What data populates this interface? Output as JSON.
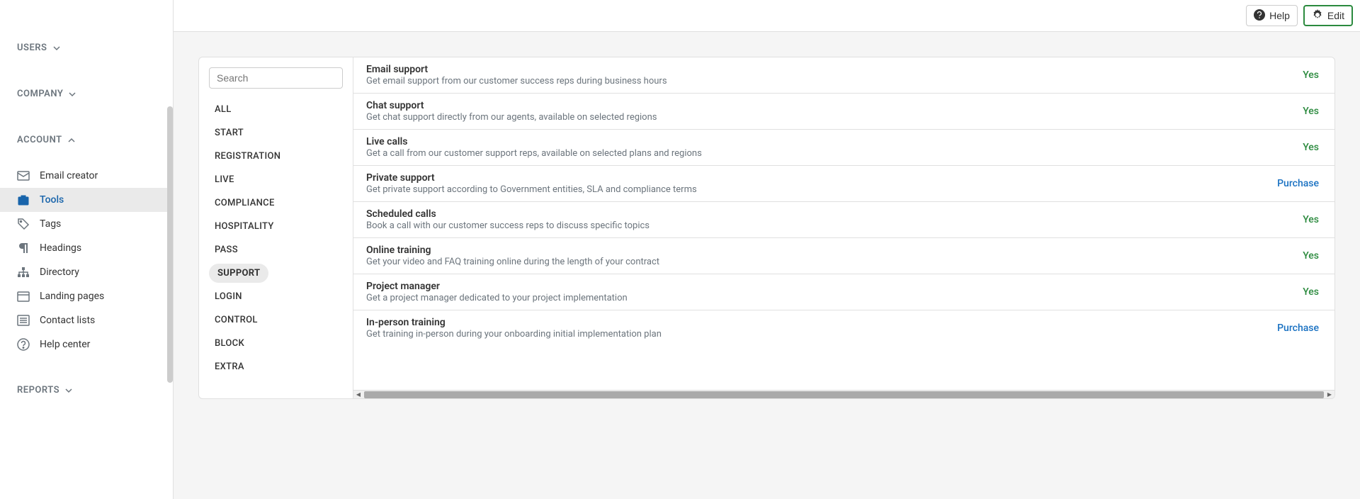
{
  "topbar": {
    "help_label": "Help",
    "edit_label": "Edit"
  },
  "sidebar": {
    "sections": {
      "users": "USERS",
      "company": "COMPANY",
      "account": "ACCOUNT",
      "reports": "REPORTS"
    },
    "account_items": [
      {
        "label": "Email creator",
        "icon": "envelope",
        "active": false
      },
      {
        "label": "Tools",
        "icon": "toolbox",
        "active": true
      },
      {
        "label": "Tags",
        "icon": "tag",
        "active": false
      },
      {
        "label": "Headings",
        "icon": "paragraph",
        "active": false
      },
      {
        "label": "Directory",
        "icon": "sitemap",
        "active": false
      },
      {
        "label": "Landing pages",
        "icon": "window",
        "active": false
      },
      {
        "label": "Contact lists",
        "icon": "list",
        "active": false
      },
      {
        "label": "Help center",
        "icon": "question",
        "active": false
      }
    ]
  },
  "filters": {
    "search_placeholder": "Search",
    "items": [
      {
        "label": "ALL",
        "active": false
      },
      {
        "label": "START",
        "active": false
      },
      {
        "label": "REGISTRATION",
        "active": false
      },
      {
        "label": "LIVE",
        "active": false
      },
      {
        "label": "COMPLIANCE",
        "active": false
      },
      {
        "label": "HOSPITALITY",
        "active": false
      },
      {
        "label": "PASS",
        "active": false
      },
      {
        "label": "SUPPORT",
        "active": true
      },
      {
        "label": "LOGIN",
        "active": false
      },
      {
        "label": "CONTROL",
        "active": false
      },
      {
        "label": "BLOCK",
        "active": false
      },
      {
        "label": "EXTRA",
        "active": false
      }
    ]
  },
  "features": [
    {
      "title": "Email support",
      "desc": "Get email support from our customer success reps during business hours",
      "status": "Yes",
      "type": "yes"
    },
    {
      "title": "Chat support",
      "desc": "Get chat support directly from our agents, available on selected regions",
      "status": "Yes",
      "type": "yes"
    },
    {
      "title": "Live calls",
      "desc": "Get a call from our customer support reps, available on selected plans and regions",
      "status": "Yes",
      "type": "yes"
    },
    {
      "title": "Private support",
      "desc": "Get private support according to Government entities, SLA and compliance terms",
      "status": "Purchase",
      "type": "purchase"
    },
    {
      "title": "Scheduled calls",
      "desc": "Book a call with our customer success reps to discuss specific topics",
      "status": "Yes",
      "type": "yes"
    },
    {
      "title": "Online training",
      "desc": "Get your video and FAQ training online during the length of your contract",
      "status": "Yes",
      "type": "yes"
    },
    {
      "title": "Project manager",
      "desc": "Get a project manager dedicated to your project implementation",
      "status": "Yes",
      "type": "yes"
    },
    {
      "title": "In-person training",
      "desc": "Get training in-person during your onboarding initial implementation plan",
      "status": "Purchase",
      "type": "purchase"
    }
  ]
}
